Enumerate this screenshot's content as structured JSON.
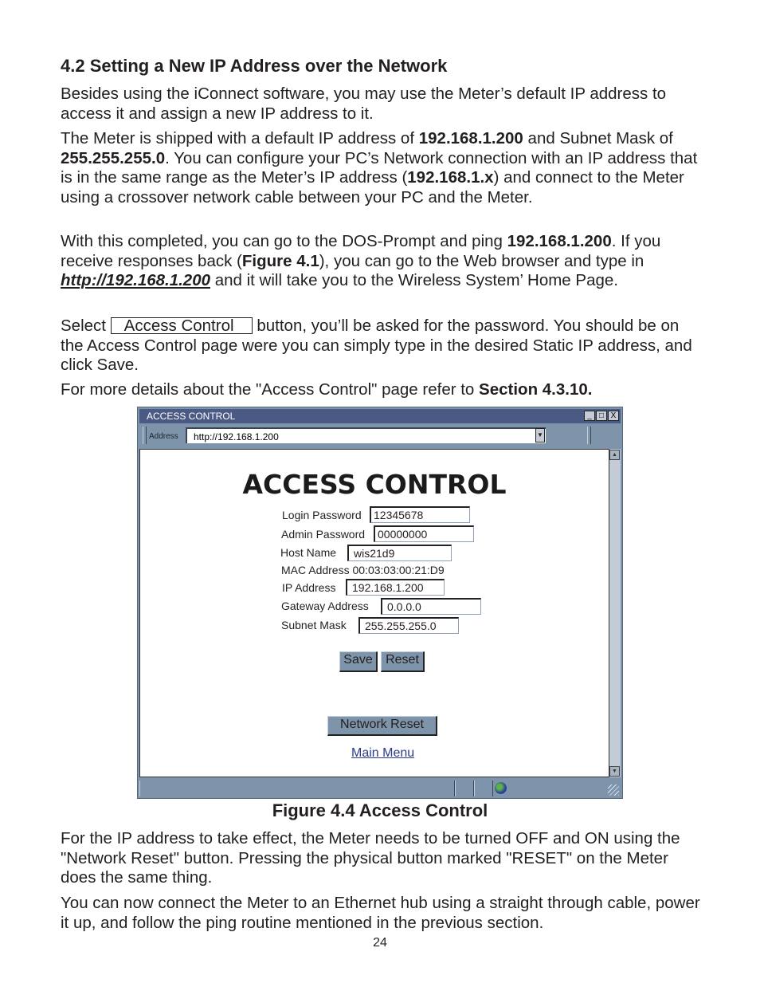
{
  "heading": "4.2 Setting a New IP Address over the Network",
  "p1": "Besides using the iConnect software, you may use the Meter’s default IP address to access it and assign a new IP address to it.",
  "p2": {
    "t1": "The Meter is shipped with a default IP address of ",
    "ip": "192.168.1.200",
    "t2": " and Subnet Mask of ",
    "mask": "255.255.255.0",
    "t3": ".  You can configure your PC’s Network connection with an IP address that is in the same range as the Meter’s IP address (",
    "range": "192.168.1.x",
    "t4": ") and connect to the Meter using a crossover network cable between your PC and the Meter."
  },
  "p3": {
    "t1": "With this completed, you can go to the DOS-Prompt and ping ",
    "ip": "192.168.1.200",
    "t2": ". If you receive responses back (",
    "fig": "Figure 4.1",
    "t3": "), you can go to the Web browser and type in ",
    "url": "http://192.168.1.200",
    "t4": " and it will take you to the Wireless System’ Home Page."
  },
  "p4": {
    "t1": "Select ",
    "button": "Access Control",
    "t2": " button, you’ll be asked for the password. You should be on the Access Control page were you can simply type in the desired Static IP address, and click Save."
  },
  "p5": {
    "t1": "For more details about the \"Access Control\" page refer to ",
    "section": "Section 4.3.10."
  },
  "browser": {
    "title": "ACCESS CONTROL",
    "address_label": "Address",
    "address_value": "http://192.168.1.200",
    "window_buttons": [
      "_",
      "□",
      "X"
    ],
    "page_title": "ACCESS CONTROL",
    "fields": {
      "login_password": {
        "label": "Login Password",
        "value": "12345678"
      },
      "admin_password": {
        "label": "Admin Password",
        "value": "00000000"
      },
      "host_name": {
        "label": "Host Name",
        "value": "wis21d9"
      },
      "mac_address": {
        "label": "MAC Address",
        "value": "00:03:03:00:21:D9"
      },
      "ip_address": {
        "label": "IP Address",
        "value": "192.168.1.200"
      },
      "gateway_address": {
        "label": "Gateway Address",
        "value": "0.0.0.0"
      },
      "subnet_mask": {
        "label": "Subnet Mask",
        "value": "255.255.255.0"
      }
    },
    "save_label": "Save",
    "reset_label": "Reset",
    "network_reset_label": "Network Reset",
    "main_menu_label": "Main Menu",
    "status_icon": "globe-icon"
  },
  "caption": "Figure 4.4  Access Control",
  "p6": "For the IP address to take effect, the Meter needs to be turned OFF and ON using the \"Network Reset\" button. Pressing the physical button marked \"RESET\" on the Meter does the same thing.",
  "p7": "You can now connect the Meter to an Ethernet hub using a straight through cable, power it up, and follow the ping routine mentioned in the previous section.",
  "page_number": "24"
}
